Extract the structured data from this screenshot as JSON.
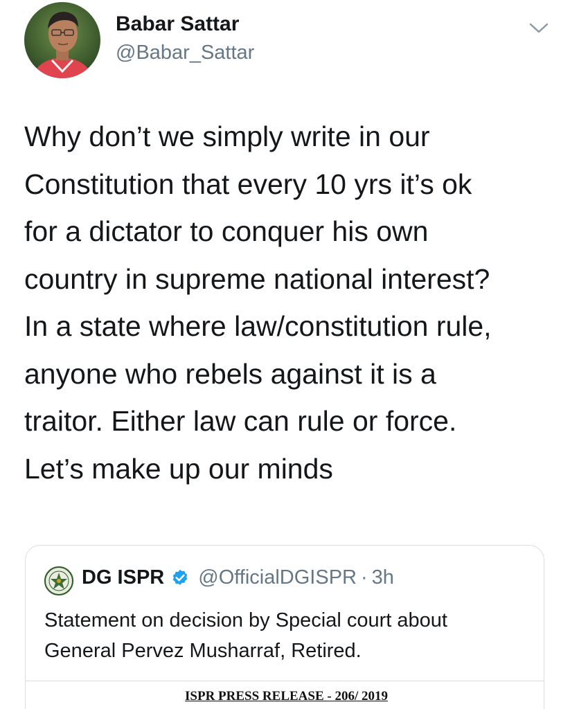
{
  "author": {
    "name": "Babar Sattar",
    "handle": "@Babar_Sattar"
  },
  "tweet": {
    "lines": [
      "Why don’t we simply write in our",
      "Constitution that every 10 yrs it’s ok",
      "for a dictator to conquer his own",
      "country in supreme national interest?",
      "In a state where law/constitution rule,",
      "anyone who rebels against it is a",
      "traitor. Either law can rule or force.",
      "Let’s make up our minds"
    ]
  },
  "quoted_tweet": {
    "name": "DG ISPR",
    "handle": "@OfficialDGISPR",
    "separator": "·",
    "time": "3h",
    "lines": [
      "Statement on decision by Special court about",
      "General Pervez Musharraf, Retired."
    ],
    "media_title": "ISPR PRESS RELEASE - 206/ 2019"
  },
  "icons": {
    "more": "chevron-down-icon",
    "verified": "verified-badge-icon",
    "author_avatar": "profile-photo",
    "quote_avatar": "ispr-emblem"
  },
  "colors": {
    "text_primary": "#14171a",
    "text_secondary": "#657786",
    "verified_blue": "#1da1f2",
    "border": "#d9dde1"
  }
}
